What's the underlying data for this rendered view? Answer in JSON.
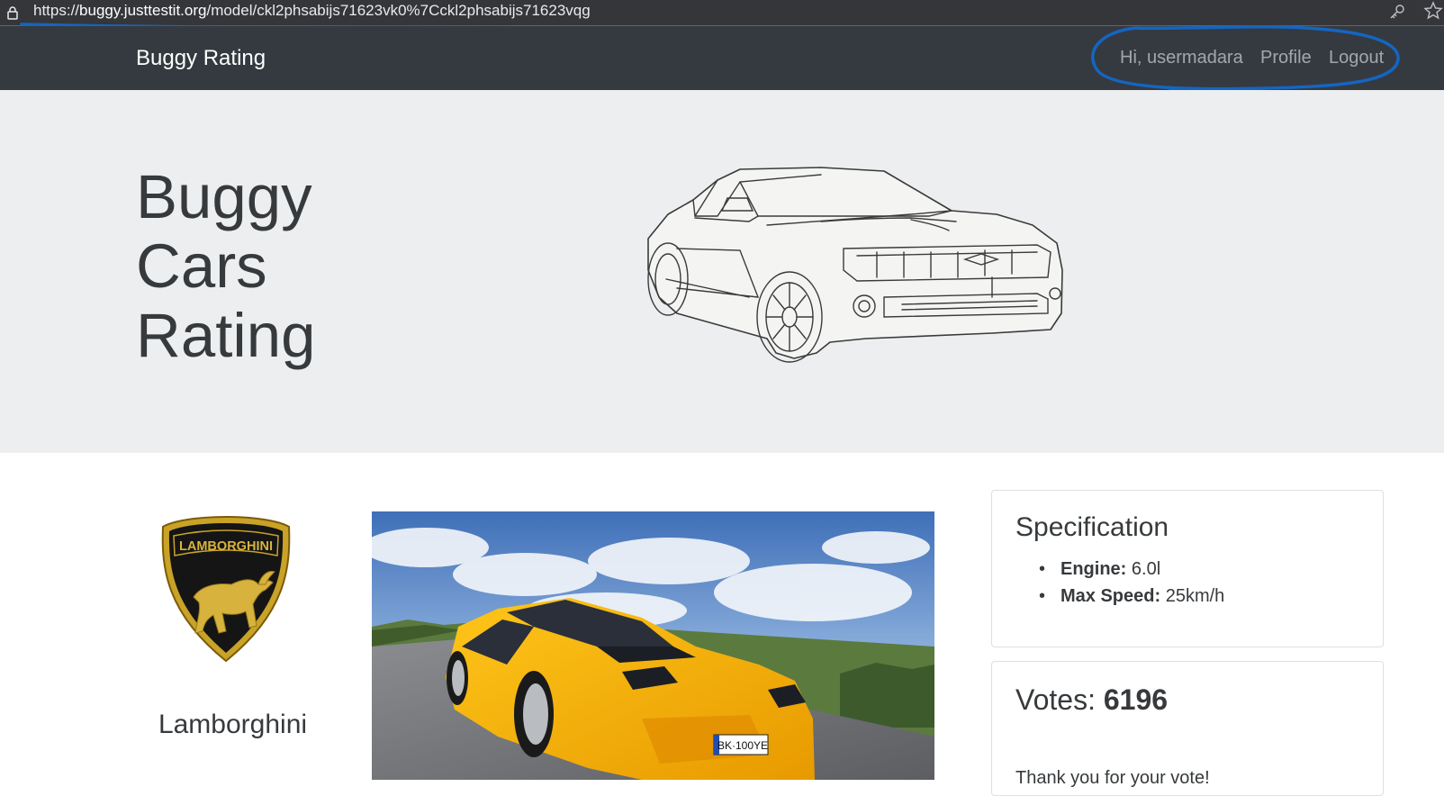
{
  "browser": {
    "url_prefix": "https://",
    "url_domain": "buggy.justtestit.org",
    "url_path": "/model/ckl2phsabijs71623vk0%7Cckl2phsabijs71623vqg"
  },
  "navbar": {
    "brand": "Buggy Rating",
    "greeting": "Hi, usermadara",
    "profile": "Profile",
    "logout": "Logout"
  },
  "hero": {
    "title_lines": [
      "Buggy",
      "Cars",
      "Rating"
    ]
  },
  "make": {
    "name": "Lamborghini",
    "logo_text": "LAMBORGHINI"
  },
  "specification": {
    "title": "Specification",
    "engine_label": "Engine:",
    "engine_value": "6.0l",
    "speed_label": "Max Speed:",
    "speed_value": "25km/h"
  },
  "votes": {
    "label": "Votes:",
    "count": "6196",
    "message": "Thank you for your vote!"
  },
  "colors": {
    "navbar": "#343a40",
    "jumbotron": "#eceeef",
    "annotation": "#1565c0",
    "car": "#f5b40f"
  }
}
